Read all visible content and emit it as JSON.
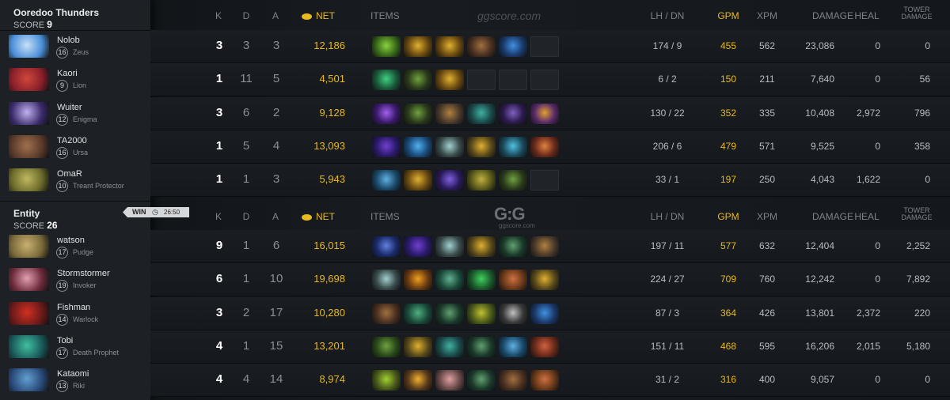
{
  "headers": {
    "k": "K",
    "d": "D",
    "a": "A",
    "net": "NET",
    "items": "ITEMS",
    "lhdn": "LH / DN",
    "gpm": "GPM",
    "xpm": "XPM",
    "damage": "DAMAGE",
    "heal": "HEAL",
    "tower_line1": "TOWER",
    "tower_line2": "DAMAGE"
  },
  "watermark_text": "ggscore.com",
  "logo_text": "G:G",
  "logo_sub": "ggscore.com",
  "win_badge": {
    "label": "WIN",
    "time": "26:50"
  },
  "teams": [
    {
      "name": "Ooredoo Thunders",
      "score_label": "SCORE",
      "score": "9",
      "players": [
        {
          "name": "Nolob",
          "level": "16",
          "hero": "Zeus",
          "k": "3",
          "d": "3",
          "a": "3",
          "net": "12,186",
          "lhdn": "174 / 9",
          "gpm": "455",
          "xpm": "562",
          "damage": "23,086",
          "heal": "0",
          "tower": "0"
        },
        {
          "name": "Kaori",
          "level": "9",
          "hero": "Lion",
          "k": "1",
          "d": "11",
          "a": "5",
          "net": "4,501",
          "lhdn": "6 / 2",
          "gpm": "150",
          "xpm": "211",
          "damage": "7,640",
          "heal": "0",
          "tower": "56"
        },
        {
          "name": "Wuiter",
          "level": "12",
          "hero": "Enigma",
          "k": "3",
          "d": "6",
          "a": "2",
          "net": "9,128",
          "lhdn": "130 / 22",
          "gpm": "352",
          "xpm": "335",
          "damage": "10,408",
          "heal": "2,972",
          "tower": "796"
        },
        {
          "name": "TA2000",
          "level": "16",
          "hero": "Ursa",
          "k": "1",
          "d": "5",
          "a": "4",
          "net": "13,093",
          "lhdn": "206 / 6",
          "gpm": "479",
          "xpm": "571",
          "damage": "9,525",
          "heal": "0",
          "tower": "358"
        },
        {
          "name": "OmaR",
          "level": "10",
          "hero": "Treant Protector",
          "k": "1",
          "d": "1",
          "a": "3",
          "net": "5,943",
          "lhdn": "33 / 1",
          "gpm": "197",
          "xpm": "250",
          "damage": "4,043",
          "heal": "1,622",
          "tower": "0"
        }
      ]
    },
    {
      "name": "Entity",
      "score_label": "SCORE",
      "score": "26",
      "players": [
        {
          "name": "watson",
          "level": "17",
          "hero": "Pudge",
          "k": "9",
          "d": "1",
          "a": "6",
          "net": "16,015",
          "lhdn": "197 / 11",
          "gpm": "577",
          "xpm": "632",
          "damage": "12,404",
          "heal": "0",
          "tower": "2,252"
        },
        {
          "name": "Stormstormer",
          "level": "19",
          "hero": "Invoker",
          "k": "6",
          "d": "1",
          "a": "10",
          "net": "19,698",
          "lhdn": "224 / 27",
          "gpm": "709",
          "xpm": "760",
          "damage": "12,242",
          "heal": "0",
          "tower": "7,892"
        },
        {
          "name": "Fishman",
          "level": "14",
          "hero": "Warlock",
          "k": "3",
          "d": "2",
          "a": "17",
          "net": "10,280",
          "lhdn": "87 / 3",
          "gpm": "364",
          "xpm": "426",
          "damage": "13,801",
          "heal": "2,372",
          "tower": "220"
        },
        {
          "name": "Tobi",
          "level": "17",
          "hero": "Death Prophet",
          "k": "4",
          "d": "1",
          "a": "15",
          "net": "13,201",
          "lhdn": "151 / 11",
          "gpm": "468",
          "xpm": "595",
          "damage": "16,206",
          "heal": "2,015",
          "tower": "5,180"
        },
        {
          "name": "Kataomi",
          "level": "13",
          "hero": "Riki",
          "k": "4",
          "d": "4",
          "a": "14",
          "net": "8,974",
          "lhdn": "31 / 2",
          "gpm": "316",
          "xpm": "400",
          "damage": "9,057",
          "heal": "0",
          "tower": "0"
        }
      ]
    }
  ],
  "portrait_colors": [
    [
      "#4a8fd8",
      "#c8e0f8"
    ],
    [
      "#8a1f2a",
      "#d0483a"
    ],
    [
      "#3a2a6a",
      "#c0b0f0"
    ],
    [
      "#5a3a2a",
      "#a07050"
    ],
    [
      "#6a6a2a",
      "#c0b860"
    ],
    [
      "#7a6a3a",
      "#c8b070"
    ],
    [
      "#6a2a3a",
      "#e0a0b0"
    ],
    [
      "#6a1a1a",
      "#d03020"
    ],
    [
      "#1a5a5a",
      "#40c0a0"
    ],
    [
      "#2a4a7a",
      "#60a0d0"
    ]
  ],
  "items": [
    [
      [
        "#3a6a1a",
        "#8ad040"
      ],
      [
        "#6a4a10",
        "#e0b030"
      ],
      [
        "#6a4a10",
        "#e0b030"
      ],
      [
        "#4a3020",
        "#a07040"
      ],
      [
        "#1a3a6a",
        "#4090e0"
      ],
      null
    ],
    [
      [
        "#1a5a3a",
        "#40d080"
      ],
      [
        "#2a3a1a",
        "#70a040"
      ],
      [
        "#6a4a10",
        "#e0b030"
      ],
      null,
      null,
      null
    ],
    [
      [
        "#3a1a6a",
        "#a060f0"
      ],
      [
        "#2a3a1a",
        "#70a040"
      ],
      [
        "#4a3a2a",
        "#b08040"
      ],
      [
        "#1a4a4a",
        "#40b0a0"
      ],
      [
        "#2a1a4a",
        "#8060c0"
      ],
      [
        "#5a2a6a",
        "#e0a030"
      ]
    ],
    [
      [
        "#2a1a6a",
        "#7040d0"
      ],
      [
        "#1a4a7a",
        "#50b0f0"
      ],
      [
        "#3a4a4a",
        "#a0d0d0"
      ],
      [
        "#5a4a1a",
        "#e0b030"
      ],
      [
        "#1a4a5a",
        "#50c0e0"
      ],
      [
        "#6a2a1a",
        "#e08040"
      ]
    ],
    [
      [
        "#1a4a6a",
        "#60b0e0"
      ],
      [
        "#6a4a10",
        "#e0b030"
      ],
      [
        "#2a1a5a",
        "#8060e0"
      ],
      [
        "#5a5a1a",
        "#c0b040"
      ],
      [
        "#2a3a1a",
        "#70a040"
      ],
      null
    ],
    [
      [
        "#1a2a6a",
        "#6080e0"
      ],
      [
        "#2a1a6a",
        "#7040d0"
      ],
      [
        "#3a4a4a",
        "#a0d0d0"
      ],
      [
        "#5a4a1a",
        "#e0b030"
      ],
      [
        "#1a3a2a",
        "#60a070"
      ],
      [
        "#4a3a2a",
        "#b08040"
      ]
    ],
    [
      [
        "#3a4a4a",
        "#a0d0d0"
      ],
      [
        "#6a3a10",
        "#f0a020"
      ],
      [
        "#1a4a3a",
        "#60b090"
      ],
      [
        "#1a5a2a",
        "#40d060"
      ],
      [
        "#6a3a1a",
        "#d07040"
      ],
      [
        "#5a4a1a",
        "#e0b030"
      ]
    ],
    [
      [
        "#4a3020",
        "#a07040"
      ],
      [
        "#1a4a3a",
        "#50b080"
      ],
      [
        "#1a3a2a",
        "#60a070"
      ],
      [
        "#4a5a1a",
        "#c0c030"
      ],
      [
        "#3a3a3a",
        "#c0c0c0"
      ],
      [
        "#1a3a6a",
        "#4090e0"
      ]
    ],
    [
      [
        "#2a4a1a",
        "#70a040"
      ],
      [
        "#5a4a1a",
        "#e0b030"
      ],
      [
        "#1a4a4a",
        "#40b0a0"
      ],
      [
        "#1a3a2a",
        "#60a070"
      ],
      [
        "#1a4a6a",
        "#60b0e0"
      ],
      [
        "#6a2a1a",
        "#d06040"
      ]
    ],
    [
      [
        "#4a5a1a",
        "#a0d030"
      ],
      [
        "#5a3a1a",
        "#f0b030"
      ],
      [
        "#6a4a4a",
        "#e0a0a0"
      ],
      [
        "#1a3a2a",
        "#60a070"
      ],
      [
        "#4a3020",
        "#a07040"
      ],
      [
        "#6a3a1a",
        "#d07040"
      ]
    ]
  ]
}
